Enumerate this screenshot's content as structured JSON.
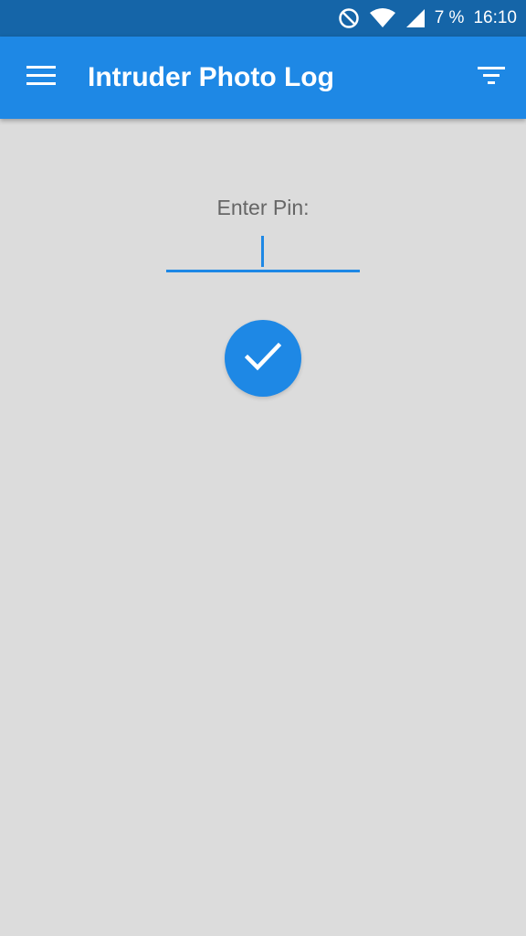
{
  "status_bar": {
    "battery": "7 %",
    "time": "16:10",
    "icons": [
      "do-not-disturb-icon",
      "wifi-icon",
      "signal-icon"
    ]
  },
  "app_bar": {
    "title": "Intruder Photo Log",
    "menu_icon": "hamburger-menu-icon",
    "filter_icon": "filter-icon",
    "background_color": "#1e88e5"
  },
  "pin_form": {
    "label": "Enter Pin:",
    "value": "",
    "confirm_icon": "check-icon",
    "accent_color": "#1e88e5"
  }
}
